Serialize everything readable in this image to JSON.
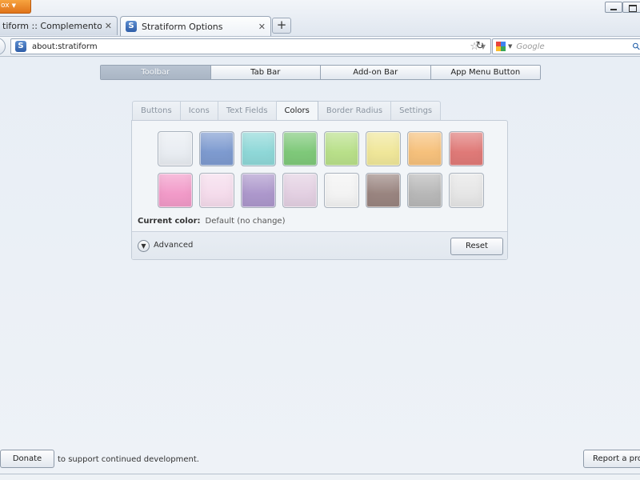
{
  "browser": {
    "app_menu_label": "ox",
    "tabs": [
      {
        "title": "tiform :: Complementos par...",
        "active": false
      },
      {
        "title": "Stratiform Options",
        "active": true
      }
    ],
    "new_tab_symbol": "+",
    "url": "about:stratiform",
    "search_placeholder": "Google"
  },
  "top_nav": {
    "buttons": [
      {
        "label": "Toolbar",
        "active": true
      },
      {
        "label": "Tab Bar",
        "active": false
      },
      {
        "label": "Add-on Bar",
        "active": false
      },
      {
        "label": "App Menu Button",
        "active": false
      }
    ]
  },
  "sub_tabs": [
    {
      "label": "Buttons",
      "active": false
    },
    {
      "label": "Icons",
      "active": false
    },
    {
      "label": "Text Fields",
      "active": false
    },
    {
      "label": "Colors",
      "active": true
    },
    {
      "label": "Border Radius",
      "active": false
    },
    {
      "label": "Settings",
      "active": false
    }
  ],
  "colors": {
    "swatches": [
      "#e9edf2",
      "#7e9bd0",
      "#8fd8d8",
      "#7fc97a",
      "#b9e08a",
      "#f0e79a",
      "#f6c17c",
      "#e07a78",
      "#f29bc9",
      "#f5dcec",
      "#ad98cc",
      "#e3d0e2",
      "#f3f3f3",
      "#9a8580",
      "#b8b8b8",
      "#e6e6e6"
    ],
    "current_label": "Current color:",
    "current_value": "Default (no change)"
  },
  "advanced": {
    "label": "Advanced",
    "reset_label": "Reset"
  },
  "footer": {
    "donate_label": "Donate",
    "support_text": "to support continued development.",
    "report_label": "Report a pro"
  }
}
